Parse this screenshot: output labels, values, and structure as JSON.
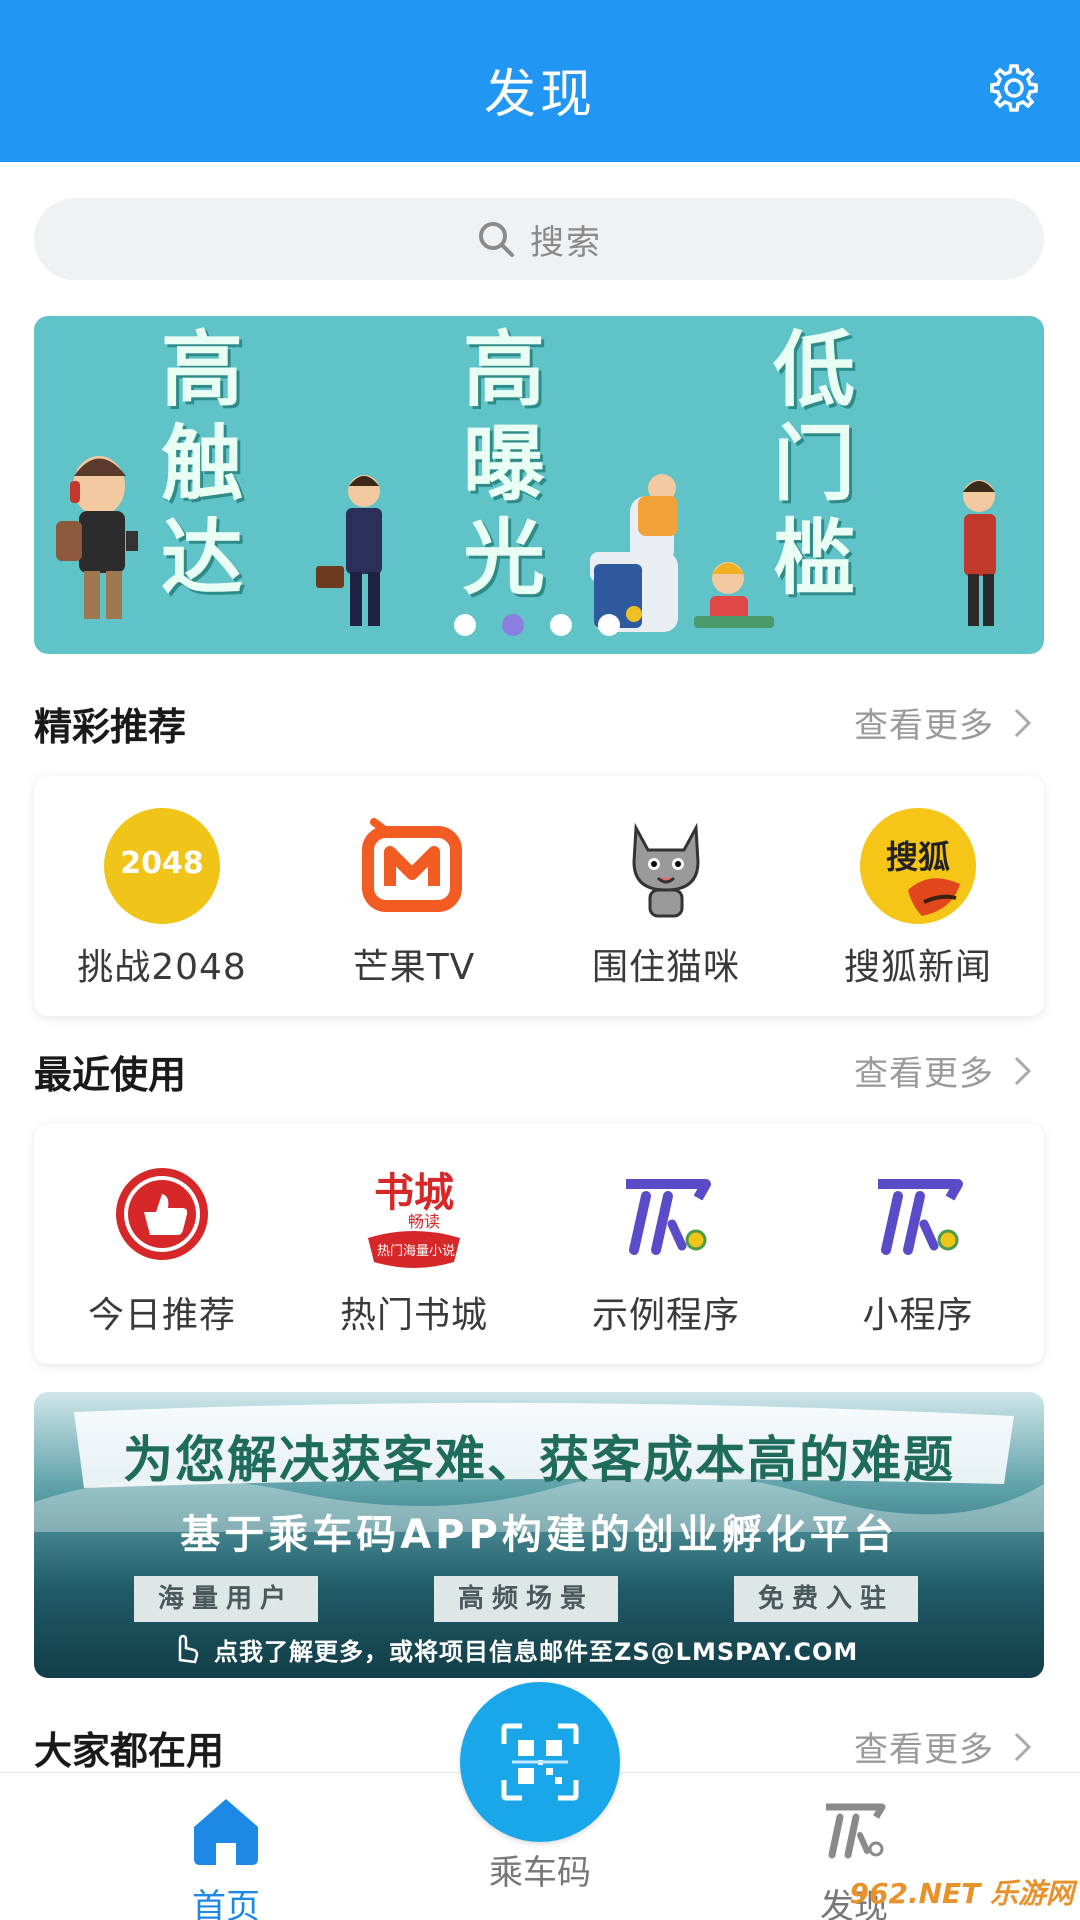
{
  "header": {
    "title": "发现",
    "settings_icon": "gear-icon"
  },
  "search": {
    "placeholder": "搜索",
    "icon": "search-icon"
  },
  "hero_banner": {
    "columns": [
      [
        "高",
        "触",
        "达"
      ],
      [
        "高",
        "曝",
        "光"
      ],
      [
        "低",
        "门",
        "槛"
      ]
    ],
    "indicator": {
      "count": 4,
      "active_index": 1
    },
    "colors": {
      "background": "#5fc3c8",
      "active_dot": "#8c7ee0"
    }
  },
  "recommended": {
    "title": "精彩推荐",
    "more_label": "查看更多",
    "apps": [
      {
        "label": "挑战2048",
        "icon": "game-2048-icon",
        "icon_text": "2048"
      },
      {
        "label": "芒果TV",
        "icon": "mango-tv-icon"
      },
      {
        "label": "围住猫咪",
        "icon": "cat-icon"
      },
      {
        "label": "搜狐新闻",
        "icon": "sohu-news-icon",
        "icon_text": "搜狐"
      }
    ]
  },
  "recent": {
    "title": "最近使用",
    "more_label": "查看更多",
    "apps": [
      {
        "label": "今日推荐",
        "icon": "thumbs-up-icon"
      },
      {
        "label": "热门书城",
        "icon": "book-city-icon",
        "icon_text": "书城",
        "icon_sub": "畅读",
        "icon_band": "热门海量小说"
      },
      {
        "label": "示例程序",
        "icon": "mini-program-icon"
      },
      {
        "label": "小程序",
        "icon": "mini-program-icon"
      }
    ]
  },
  "promo_banner": {
    "line1": "为您解决获客难、获客成本高的难题",
    "line2": "基于乘车码APP构建的创业孵化平台",
    "tags": [
      "海量用户",
      "高频场景",
      "免费入驻"
    ],
    "footer": "点我了解更多，或将项目信息邮件至ZS@LMSPAY.COM"
  },
  "everyone": {
    "title": "大家都在用",
    "more_label": "查看更多"
  },
  "tabbar": {
    "items": [
      {
        "label": "首页",
        "icon": "home-icon",
        "active": true
      },
      {
        "label": "乘车码",
        "icon": "qr-code-icon",
        "active": false
      },
      {
        "label": "发现",
        "icon": "discover-icon",
        "active": false
      }
    ],
    "colors": {
      "active": "#1e88e5",
      "inactive": "#777777"
    }
  },
  "watermark": "962.NET 乐游网"
}
